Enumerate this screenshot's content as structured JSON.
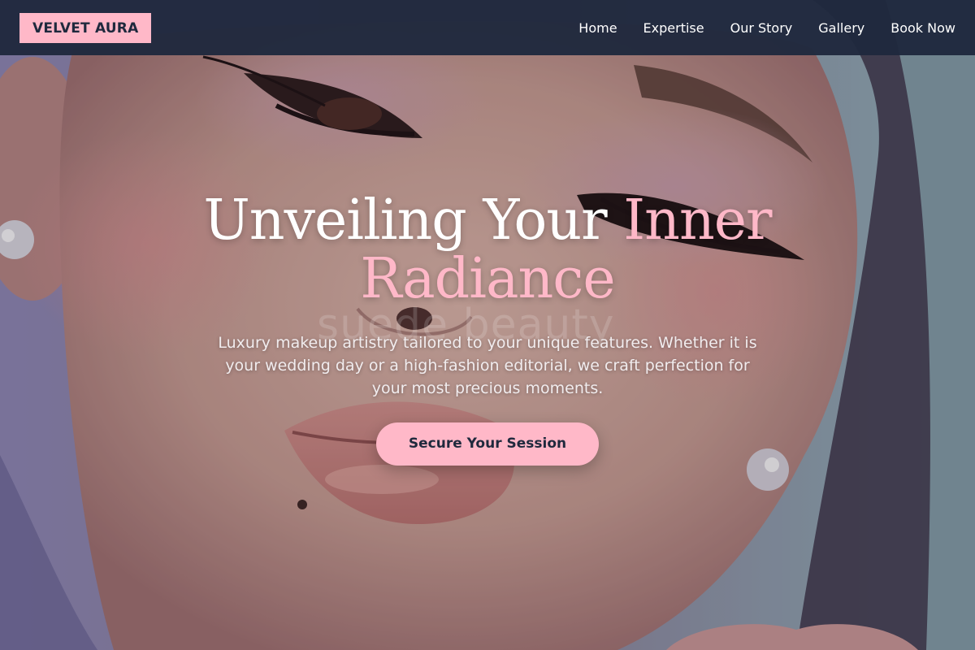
{
  "navbar": {
    "brand": "VELVET AURA",
    "links": [
      "Home",
      "Expertise",
      "Our Story",
      "Gallery",
      "Book Now"
    ]
  },
  "hero": {
    "headline_part1": "Unveiling Your ",
    "headline_part2": "Inner",
    "headline_part3": "Radiance",
    "subtitle": "Luxury makeup artistry tailored to your unique features. Whether it is your wedding day or a high-fashion editorial, we craft perfection for your most precious moments.",
    "cta_label": "Secure Your Session",
    "photo_watermark": "suede beauty"
  },
  "colors": {
    "navbar_bg": "#1f293d",
    "accent_pink": "#ffb8c8",
    "text_white": "#ffffff"
  }
}
